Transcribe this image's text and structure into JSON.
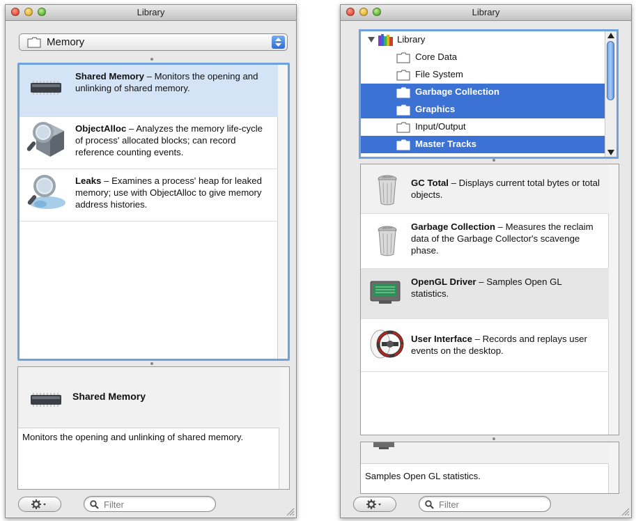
{
  "left_window": {
    "title": "Library",
    "category_popup": {
      "selected": "Memory"
    },
    "instruments": [
      {
        "name": "Shared Memory",
        "description": " – Monitors the opening and unlinking of shared memory.",
        "icon": "chip-icon"
      },
      {
        "name": "ObjectAlloc",
        "description": "  – Analyzes the memory life-cycle of process' allocated blocks; can record reference counting events.",
        "icon": "magnifier-cube-icon"
      },
      {
        "name": "Leaks",
        "description": " – Examines a process' heap for leaked memory; use with ObjectAlloc to give memory address histories.",
        "icon": "magnifier-leak-icon"
      }
    ],
    "detail": {
      "title": "Shared Memory",
      "description": "Monitors the opening and unlinking of shared memory.",
      "icon": "chip-icon"
    },
    "filter_placeholder": "Filter"
  },
  "right_window": {
    "title": "Library",
    "tree": {
      "root": "Library",
      "groups": [
        {
          "label": "Core Data",
          "selected": false
        },
        {
          "label": "File System",
          "selected": false
        },
        {
          "label": "Garbage Collection",
          "selected": true
        },
        {
          "label": "Graphics",
          "selected": true
        },
        {
          "label": "Input/Output",
          "selected": false
        },
        {
          "label": "Master Tracks",
          "selected": true
        }
      ]
    },
    "instruments": [
      {
        "name": "GC Total",
        "description": " – Displays current total bytes or total objects.",
        "icon": "trash-can-icon"
      },
      {
        "name": "Garbage Collection",
        "description": " – Measures the reclaim data of the Garbage Collector's scavenge phase.",
        "icon": "trash-can-icon"
      },
      {
        "name": "OpenGL Driver",
        "description": " – Samples Open GL statistics.",
        "icon": "graphics-card-icon"
      },
      {
        "name": "User Interface",
        "description": " – Records and replays user events on the desktop.",
        "icon": "mouse-wheel-icon"
      }
    ],
    "detail": {
      "description": "Samples Open GL statistics."
    },
    "filter_placeholder": "Filter"
  }
}
